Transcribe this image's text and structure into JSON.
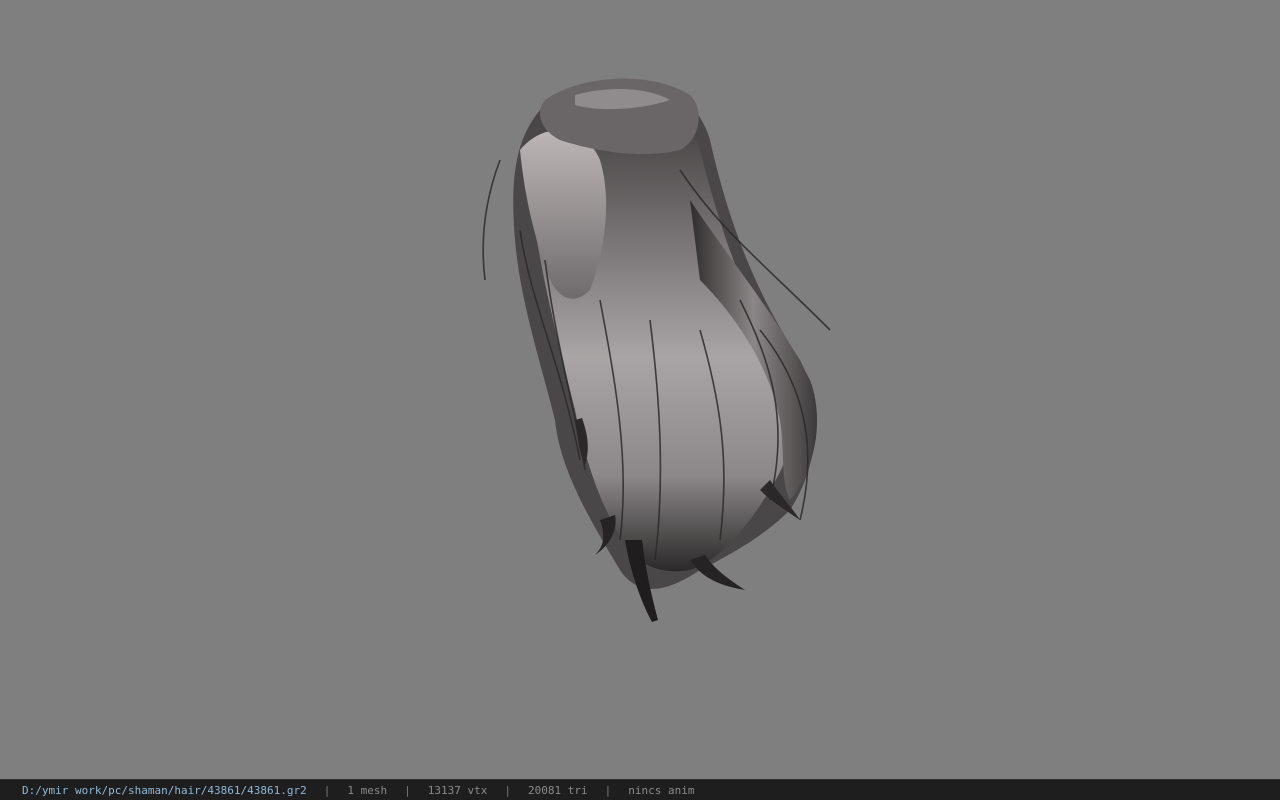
{
  "viewer": {
    "background_color": "#7f7f7f",
    "model_name": "hair-model"
  },
  "statusbar": {
    "file_path": "D:/ymir work/pc/shaman/hair/43861/43861.gr2",
    "separator": "|",
    "mesh_count": "1 mesh",
    "vertex_count": "13137 vtx",
    "triangle_count": "20081 tri",
    "anim_status": "nincs anim",
    "path_color": "#8fb8d8",
    "stat_color": "#8a8a8a"
  }
}
